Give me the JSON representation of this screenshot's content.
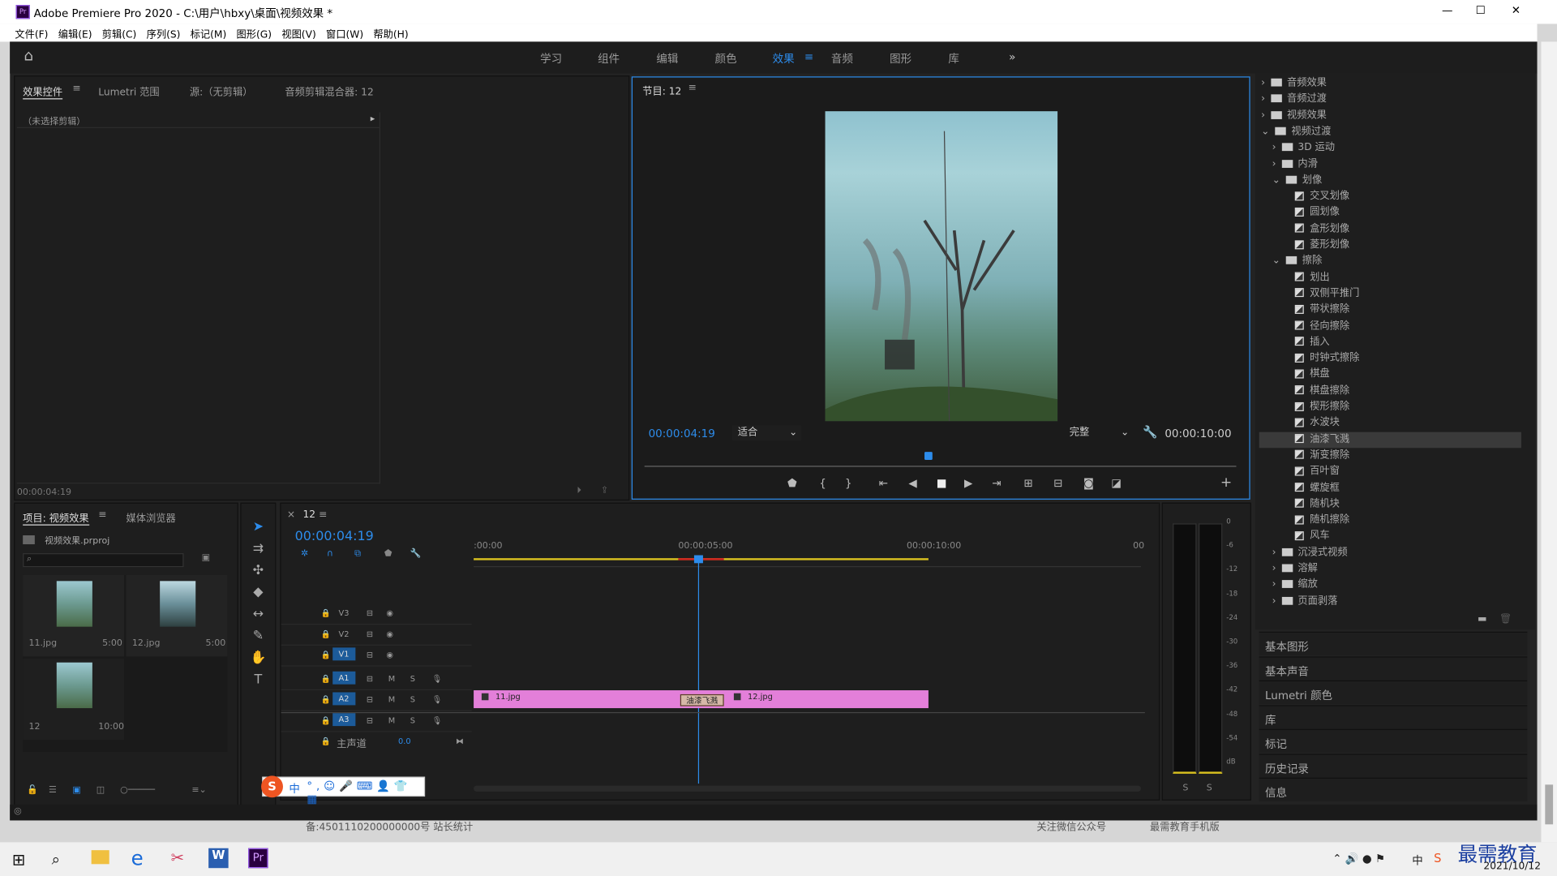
{
  "title": "Adobe Premiere Pro 2020 - C:\\用户\\hbxy\\桌面\\视频效果 *",
  "window_controls": {
    "minimize": "—",
    "maximize": "☐",
    "close": "✕"
  },
  "menu": [
    "文件(F)",
    "编辑(E)",
    "剪辑(C)",
    "序列(S)",
    "标记(M)",
    "图形(G)",
    "视图(V)",
    "窗口(W)",
    "帮助(H)"
  ],
  "workspaces": [
    "学习",
    "组件",
    "编辑",
    "颜色",
    "效果",
    "音频",
    "图形",
    "库"
  ],
  "active_workspace": "效果",
  "source_panel": {
    "tabs": [
      "效果控件",
      "Lumetri 范围",
      "源:（无剪辑）",
      "音频剪辑混合器: 12"
    ],
    "no_clip": "（未选择剪辑）",
    "timecode": "00:00:04:19"
  },
  "program": {
    "tab": "节目: 12",
    "timecode": "00:00:04:19",
    "fit": "适合",
    "quality": "完整",
    "duration": "00:00:10:00",
    "playhead": 0.48
  },
  "project": {
    "tabs": [
      "项目: 视频效果",
      "媒体浏览器"
    ],
    "file": "视频效果.prproj",
    "items": [
      {
        "name": "11.jpg",
        "dur": "5:00"
      },
      {
        "name": "12.jpg",
        "dur": "5:00"
      },
      {
        "name": "12",
        "dur": "10:00"
      }
    ]
  },
  "timeline": {
    "tab": "12",
    "timecode": "00:00:04:19",
    "ruler": [
      ":00:00",
      "00:00:05:00",
      "00:00:10:00",
      "00"
    ],
    "tracks_v": [
      "V3",
      "V2",
      "V1"
    ],
    "tracks_a": [
      "A1",
      "A2",
      "A3"
    ],
    "master": "主声道",
    "master_val": "0.0",
    "track_btn_m": "M",
    "track_btn_s": "S",
    "clips": {
      "a": "11.jpg",
      "transition": "油漆飞溅",
      "b": "12.jpg"
    }
  },
  "meter": {
    "scale": [
      "0",
      "-6",
      "-12",
      "-18",
      "-24",
      "-30",
      "-36",
      "-42",
      "-48",
      "-54",
      "dB"
    ],
    "solo": [
      "S",
      "S"
    ]
  },
  "effects_tree": [
    {
      "level": 0,
      "type": "folder",
      "label": "音频效果",
      "arrow": "›"
    },
    {
      "level": 0,
      "type": "folder",
      "label": "音频过渡",
      "arrow": "›"
    },
    {
      "level": 0,
      "type": "folder",
      "label": "视频效果",
      "arrow": "›"
    },
    {
      "level": 0,
      "type": "folder",
      "label": "视频过渡",
      "arrow": "⌄"
    },
    {
      "level": 1,
      "type": "folder",
      "label": "3D 运动",
      "arrow": "›"
    },
    {
      "level": 1,
      "type": "folder",
      "label": "内滑",
      "arrow": "›"
    },
    {
      "level": 1,
      "type": "folder",
      "label": "划像",
      "arrow": "⌄"
    },
    {
      "level": 2,
      "type": "fx",
      "label": "交叉划像"
    },
    {
      "level": 2,
      "type": "fx",
      "label": "圆划像"
    },
    {
      "level": 2,
      "type": "fx",
      "label": "盒形划像"
    },
    {
      "level": 2,
      "type": "fx",
      "label": "菱形划像"
    },
    {
      "level": 1,
      "type": "folder",
      "label": "擦除",
      "arrow": "⌄"
    },
    {
      "level": 2,
      "type": "fx",
      "label": "划出"
    },
    {
      "level": 2,
      "type": "fx",
      "label": "双侧平推门"
    },
    {
      "level": 2,
      "type": "fx",
      "label": "带状擦除"
    },
    {
      "level": 2,
      "type": "fx",
      "label": "径向擦除"
    },
    {
      "level": 2,
      "type": "fx",
      "label": "插入"
    },
    {
      "level": 2,
      "type": "fx",
      "label": "时钟式擦除"
    },
    {
      "level": 2,
      "type": "fx",
      "label": "棋盘"
    },
    {
      "level": 2,
      "type": "fx",
      "label": "棋盘擦除"
    },
    {
      "level": 2,
      "type": "fx",
      "label": "楔形擦除"
    },
    {
      "level": 2,
      "type": "fx",
      "label": "水波块"
    },
    {
      "level": 2,
      "type": "fx",
      "label": "油漆飞溅",
      "selected": true
    },
    {
      "level": 2,
      "type": "fx",
      "label": "渐变擦除"
    },
    {
      "level": 2,
      "type": "fx",
      "label": "百叶窗"
    },
    {
      "level": 2,
      "type": "fx",
      "label": "螺旋框"
    },
    {
      "level": 2,
      "type": "fx",
      "label": "随机块"
    },
    {
      "level": 2,
      "type": "fx",
      "label": "随机擦除"
    },
    {
      "level": 2,
      "type": "fx",
      "label": "风车"
    },
    {
      "level": 1,
      "type": "folder",
      "label": "沉浸式视频",
      "arrow": "›"
    },
    {
      "level": 1,
      "type": "folder",
      "label": "溶解",
      "arrow": "›"
    },
    {
      "level": 1,
      "type": "folder",
      "label": "缩放",
      "arrow": "›"
    },
    {
      "level": 1,
      "type": "folder",
      "label": "页面剥落",
      "arrow": "›"
    }
  ],
  "side_panels": [
    "基本图形",
    "基本声音",
    "Lumetri 颜色",
    "库",
    "标记",
    "历史记录",
    "信息"
  ],
  "ime_label": "中",
  "behind_text": [
    "备:4501110200000000号 站长统计",
    "关注微信公众号",
    "最需教育手机版"
  ],
  "taskbar": {
    "date": "2021/10/12",
    "lang": "中",
    "watermark": "最需教育"
  },
  "colors": {
    "accent": "#2d8ceb",
    "clip": "#e37fd9",
    "panel": "#1e1e1e",
    "bg": "#232323"
  }
}
